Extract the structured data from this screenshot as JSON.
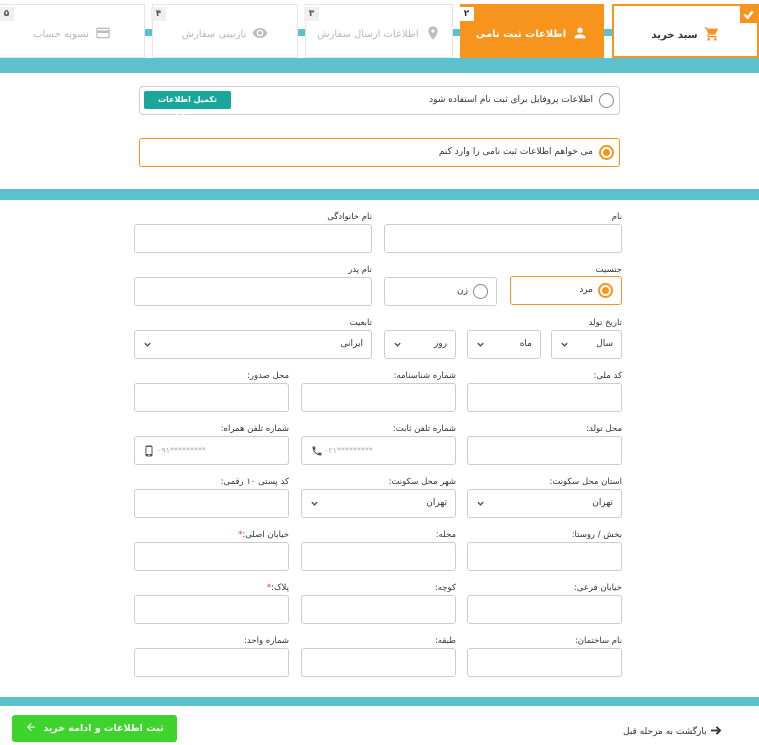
{
  "steps": [
    {
      "num": "",
      "label": "سبد خرید",
      "icon": "cart-icon"
    },
    {
      "num": "۲",
      "label": "اطلاعات ثبت نامی",
      "icon": "user-icon"
    },
    {
      "num": "۳",
      "label": "اطلاعات ارسال سفارش",
      "icon": "location-pin-icon"
    },
    {
      "num": "۴",
      "label": "بازبینی سفارش",
      "icon": "eye-icon"
    },
    {
      "num": "۵",
      "label": "تسویه حساب",
      "icon": "credit-card-icon"
    }
  ],
  "profile": {
    "use_profile_label": "اطلاعات پروفایل برای ثبت نام استفاده شود",
    "complete_profile_button": "تکمیل اطلاعات پروفایل",
    "manual_entry_label": "می خواهم اطلاعات ثبت نامی را وارد کنم"
  },
  "form": {
    "first_name_label": "نام",
    "last_name_label": "نام خانوادگی",
    "gender_label": "جنسیت",
    "gender_male": "مرد",
    "gender_female": "زن",
    "father_name_label": "نام پدر",
    "birth_date_label": "تاریخ تولد",
    "year_value": "سال",
    "month_value": "ماه",
    "day_value": "روز",
    "nationality_label": "تابعیت",
    "nationality_value": "ایرانی",
    "national_code_label": "کد ملی:",
    "id_number_label": "شماره شناسنامه:",
    "issue_place_label": "محل صدور:",
    "birth_place_label": "محل تولد:",
    "landline_label": "شماره تلفن ثابت:",
    "landline_placeholder": "۰۲۱*********",
    "mobile_label": "شماره تلفن همراه:",
    "mobile_placeholder": "۰۹۱*********",
    "province_label": "استان محل سکونت:",
    "province_value": "تهران",
    "city_label": "شهر محل سکونت:",
    "city_value": "تهران",
    "postal_code_label": "کد پستی ۱۰ رقمی:",
    "district_label": "بخش / روستا:",
    "neighborhood_label": "محله:",
    "main_street_label": "خیابان اصلی:",
    "side_street_label": "خیابان فرعی:",
    "alley_label": "کوچه:",
    "plaque_label": "پلاک:",
    "building_name_label": "نام ساختمان:",
    "floor_label": "طبقه:",
    "unit_number_label": "شماره واحد:",
    "required_mark": "*"
  },
  "actions": {
    "back_label": "بازگشت به مرحله قبل",
    "submit_label": "ثبت اطلاعات و ادامه خرید"
  },
  "colors": {
    "accent": "#f7941d",
    "teal": "#5bc2cd",
    "green": "#3ed42d",
    "button_teal": "#1aa79b"
  }
}
